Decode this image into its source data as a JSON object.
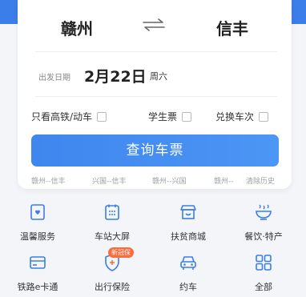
{
  "trip": {
    "from": "赣州",
    "to": "信丰",
    "date_label": "出发日期",
    "date": "2月22日",
    "weekday": "周六"
  },
  "options": [
    {
      "label": "只看高铁/动车",
      "checked": false
    },
    {
      "label": "学生票",
      "checked": false
    },
    {
      "label": "兑换车次",
      "checked": false
    }
  ],
  "query_button": "查询车票",
  "history": [
    "赣州--信丰",
    "兴国--信丰",
    "赣州--兴国",
    "赣州--",
    "清除历史"
  ],
  "services_row1": [
    {
      "label": "温馨服务",
      "icon": "warm-service-icon"
    },
    {
      "label": "车站大屏",
      "icon": "station-screen-icon"
    },
    {
      "label": "扶贫商城",
      "icon": "shop-icon"
    },
    {
      "label": "餐饮·特产",
      "icon": "food-icon"
    }
  ],
  "services_row2": [
    {
      "label": "铁路e卡通",
      "icon": "card-icon"
    },
    {
      "label": "出行保险",
      "icon": "insurance-icon",
      "badge": "新冠保"
    },
    {
      "label": "约车",
      "icon": "car-icon"
    },
    {
      "label": "全部",
      "icon": "grid-icon"
    }
  ],
  "colors": {
    "accent": "#3b7de9",
    "badge": "#ff6a3a"
  }
}
